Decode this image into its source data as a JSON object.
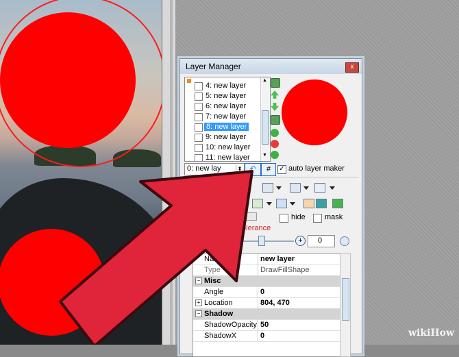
{
  "window": {
    "title": "Layer Manager",
    "close_label": "x"
  },
  "layers": [
    {
      "label": "4: new layer",
      "selected": false
    },
    {
      "label": "5: new layer",
      "selected": false
    },
    {
      "label": "6: new layer",
      "selected": false
    },
    {
      "label": "7: new layer",
      "selected": false
    },
    {
      "label": "8: new layer",
      "selected": true
    },
    {
      "label": "9: new layer",
      "selected": false
    },
    {
      "label": "10: new layer",
      "selected": false
    },
    {
      "label": "11: new layer",
      "selected": false
    }
  ],
  "layer_name_field": "0: new lay",
  "buttons": {
    "undo": "↶",
    "hash": "#"
  },
  "auto_layer_maker": {
    "label": "auto layer maker",
    "checked": true,
    "mark": "✓"
  },
  "options": {
    "hide_label": "hide",
    "mask_label": "mask",
    "tolerance_label": "tolerance",
    "tolerance_value": "0",
    "plus": "+"
  },
  "properties": [
    {
      "key": "Name",
      "value": "new layer",
      "kind": "row"
    },
    {
      "key": "Type",
      "value": "DrawFillShape",
      "kind": "row"
    },
    {
      "key": "Misc",
      "value": "",
      "kind": "category",
      "expander": "−"
    },
    {
      "key": "Angle",
      "value": "0",
      "kind": "row"
    },
    {
      "key": "Location",
      "value": "804, 470",
      "kind": "row",
      "expander": "+"
    },
    {
      "key": "Shadow",
      "value": "",
      "kind": "category",
      "expander": "−"
    },
    {
      "key": "ShadowOpacity",
      "value": "50",
      "kind": "row"
    },
    {
      "key": "ShadowX",
      "value": "0",
      "kind": "row"
    }
  ],
  "colors": {
    "shape": "#ff0000",
    "arrow": "#e0243a",
    "selection": "#3399ff"
  },
  "watermark": "wikiHow"
}
